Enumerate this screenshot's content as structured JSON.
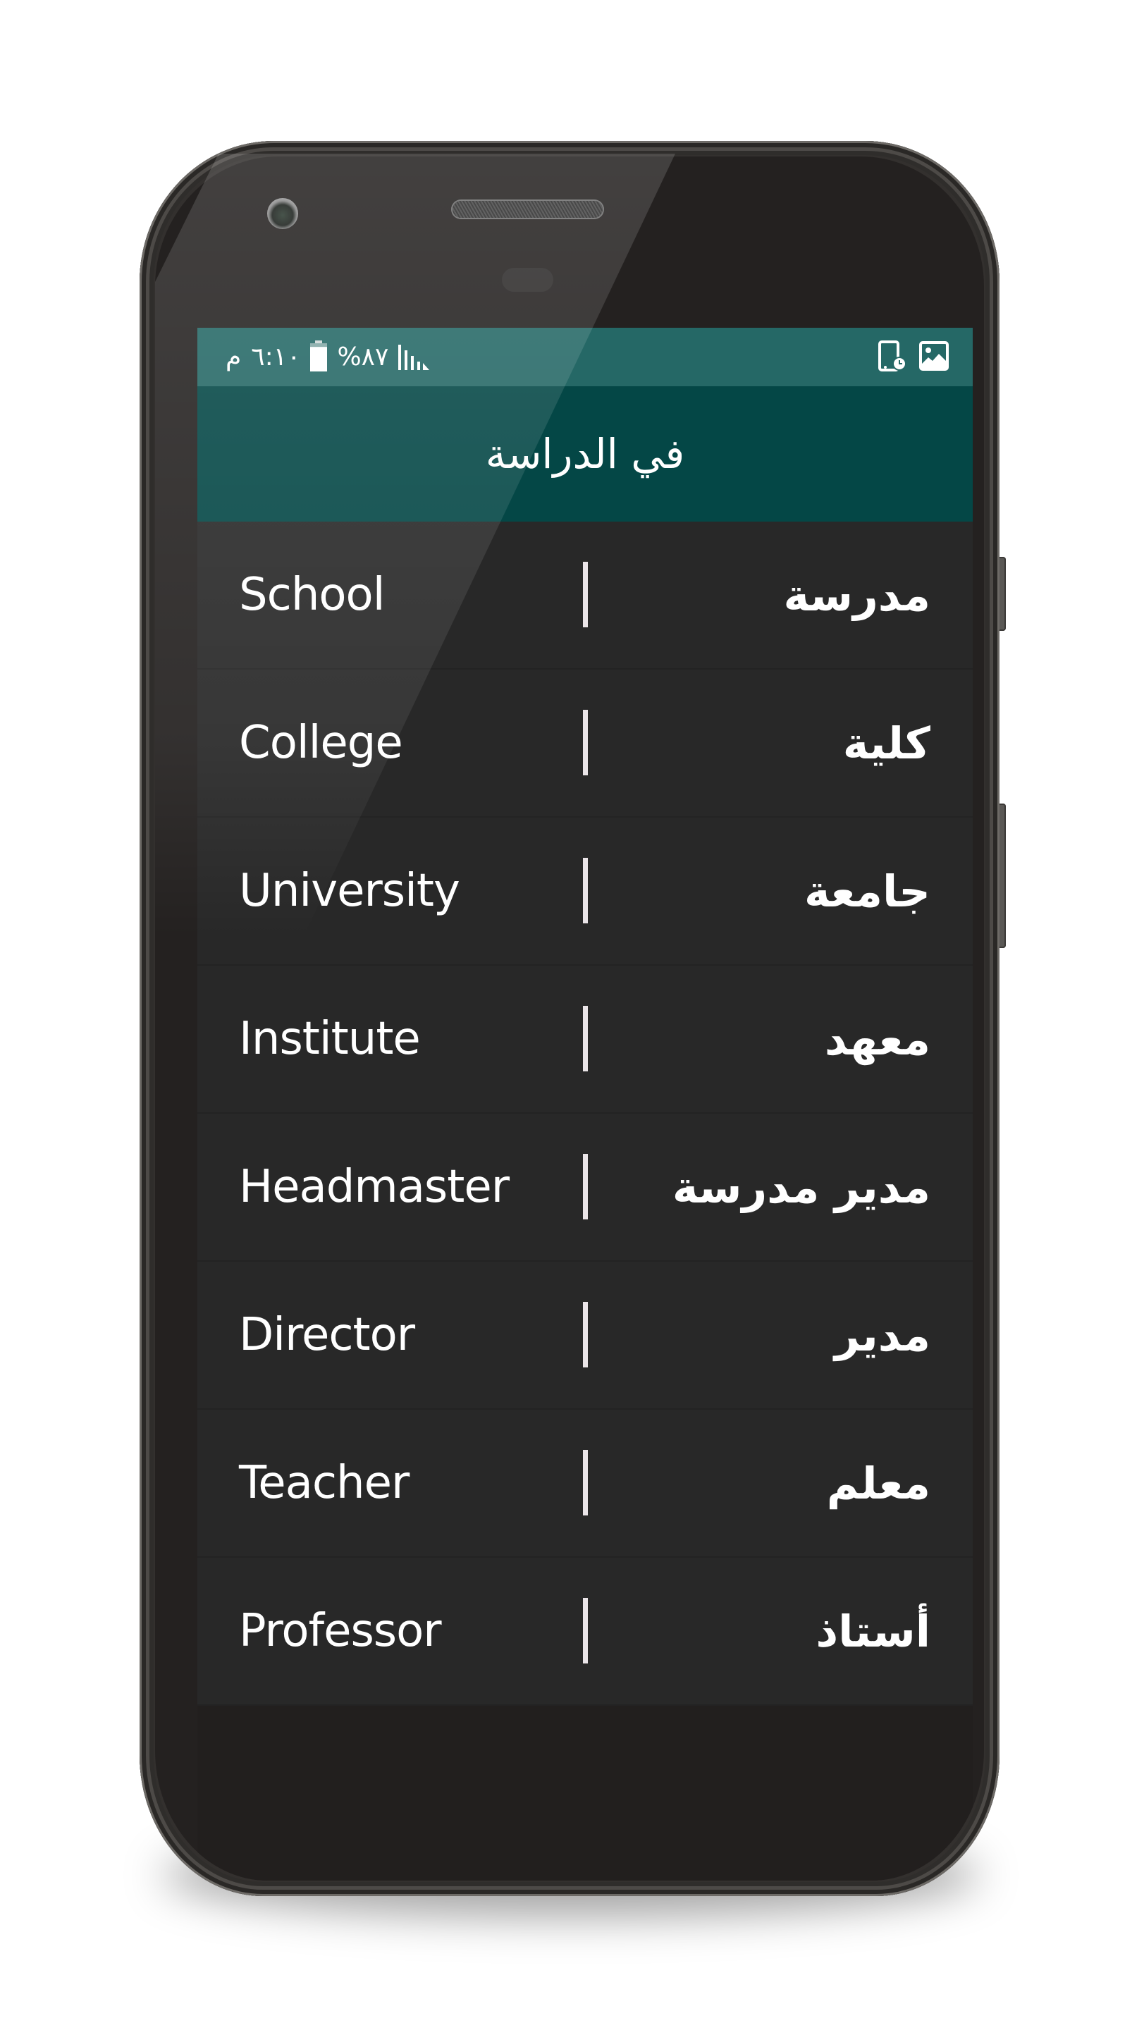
{
  "status_bar": {
    "time": "٦:١٠",
    "am_pm": "م",
    "battery_percent": "%٨٧",
    "battery_level": 0.87,
    "left_icons": [
      "signal-icon",
      "battery-icon"
    ],
    "right_icons": [
      "screen-time-icon",
      "image-icon"
    ]
  },
  "app_bar": {
    "title": "في الدراسة"
  },
  "vocabulary": [
    {
      "english": "School",
      "arabic": "مدرسة"
    },
    {
      "english": "College",
      "arabic": "كلية"
    },
    {
      "english": "University",
      "arabic": "جامعة"
    },
    {
      "english": "Institute",
      "arabic": "معهد"
    },
    {
      "english": "Headmaster",
      "arabic": "مدير مدرسة"
    },
    {
      "english": "Director",
      "arabic": "مدير"
    },
    {
      "english": "Teacher",
      "arabic": "معلم"
    },
    {
      "english": "Professor",
      "arabic": "أستاذ"
    }
  ],
  "colors": {
    "status_bar": "#256866",
    "app_bar": "#044746",
    "row_background": "#282828",
    "divider": "#ebe5e8",
    "text": "#ffffff"
  }
}
